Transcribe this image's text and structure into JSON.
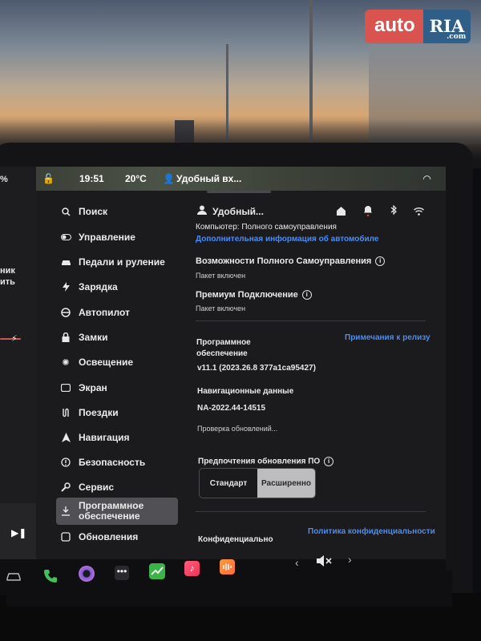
{
  "watermark": {
    "auto": "auto",
    "ria": "RIA",
    "tld": ".com"
  },
  "statusbar": {
    "left_pct": "%",
    "time": "19:51",
    "temperature": "20°C",
    "profile": "Удобный вх..."
  },
  "left_strip": {
    "text1": "ник",
    "text2": "ить",
    "play_icon": "play-pause-icon"
  },
  "sidebar": {
    "items": [
      {
        "label": "Поиск",
        "icon": "search-icon"
      },
      {
        "label": "Управление",
        "icon": "toggle-icon"
      },
      {
        "label": "Педали и руление",
        "icon": "car-icon"
      },
      {
        "label": "Зарядка",
        "icon": "bolt-icon"
      },
      {
        "label": "Автопилот",
        "icon": "steering-wheel-icon"
      },
      {
        "label": "Замки",
        "icon": "lock-icon"
      },
      {
        "label": "Освещение",
        "icon": "sun-icon"
      },
      {
        "label": "Экран",
        "icon": "display-icon"
      },
      {
        "label": "Поездки",
        "icon": "trips-icon"
      },
      {
        "label": "Навигация",
        "icon": "navigation-icon"
      },
      {
        "label": "Безопасность",
        "icon": "safety-icon"
      },
      {
        "label": "Сервис",
        "icon": "wrench-icon"
      },
      {
        "label": "Программное обеспечение",
        "icon": "download-icon"
      },
      {
        "label": "Обновления",
        "icon": "updates-icon"
      }
    ]
  },
  "header": {
    "profile_name": "Удобный..."
  },
  "content": {
    "computer_line": "Компьютер: Полного самоуправления",
    "more_info_link": "Дополнительная информация об автомобиле",
    "fsd_title": "Возможности Полного Самоуправления",
    "fsd_status": "Пакет включен",
    "premium_title": "Премиум Подключение",
    "premium_status": "Пакет включен",
    "software_title": "Программное обеспечение",
    "release_notes_link": "Примечания к релизу",
    "version": "v11.1 (2023.26.8 377a1ca95427)",
    "nav_data_title": "Навигационные данные",
    "nav_data_value": "NA-2022.44-14515",
    "check_updates": "Проверка обновлений...",
    "update_pref_title": "Предпочтения обновления ПО",
    "update_options": [
      "Стандарт",
      "Расширенно"
    ],
    "update_selected": "Расширенно",
    "privacy_title": "Конфиденциально",
    "privacy_link": "Политика конфиденциальности"
  },
  "dock": {
    "icons": [
      "car-icon",
      "phone-icon",
      "camera-icon",
      "more-icon",
      "charts-icon",
      "music-icon",
      "audio-icon"
    ],
    "prev": "‹",
    "next": "›",
    "mute_icon": "volume-mute-icon"
  }
}
